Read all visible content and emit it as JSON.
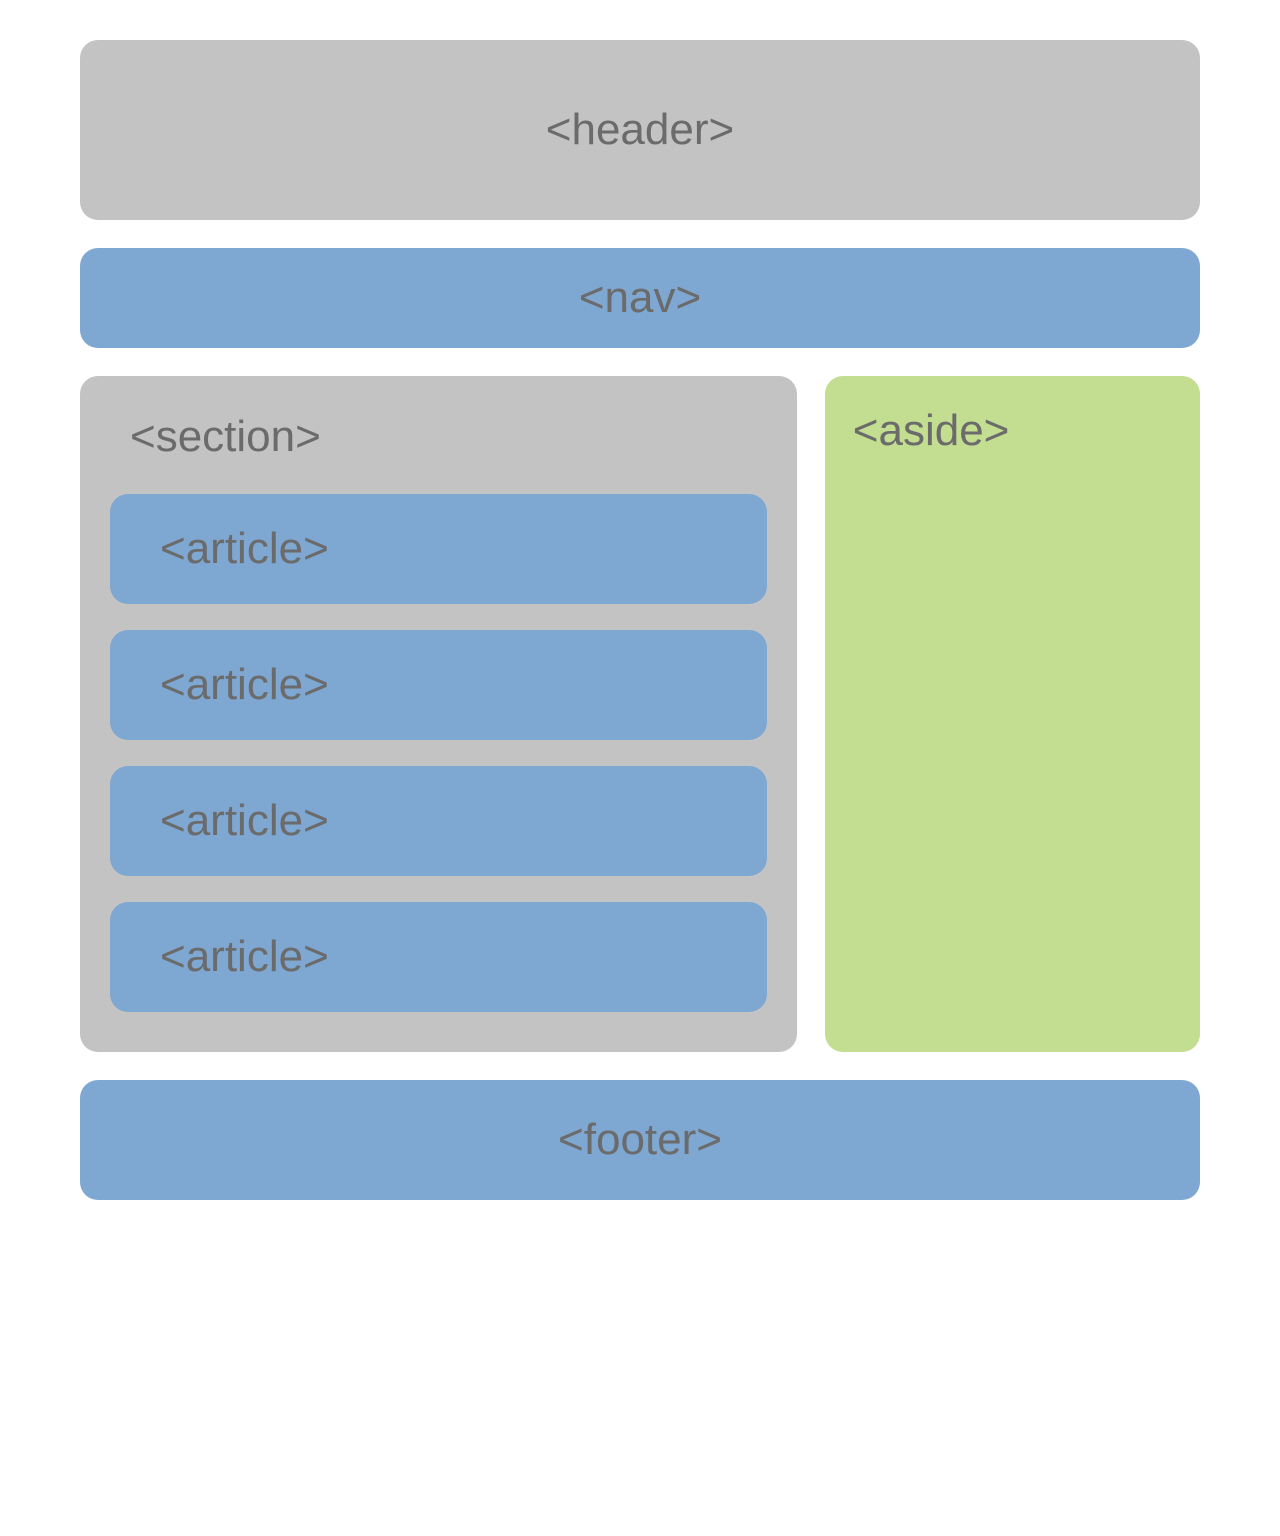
{
  "layout": {
    "header": "<header>",
    "nav": "<nav>",
    "section": "<section>",
    "articles": [
      "<article>",
      "<article>",
      "<article>",
      "<article>"
    ],
    "aside": "<aside>",
    "footer": "<footer>"
  },
  "colors": {
    "gray": "#c3c3c3",
    "blue": "#7ea7d1",
    "green": "#c3dd91",
    "text": "#6b6b6b"
  }
}
